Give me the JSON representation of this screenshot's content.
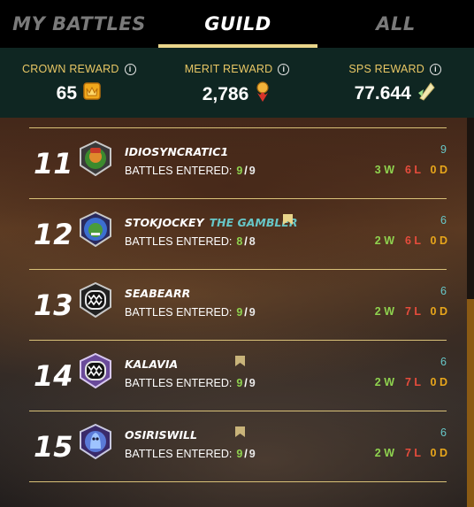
{
  "tabs": [
    {
      "label": "MY BATTLES",
      "active": false
    },
    {
      "label": "GUILD",
      "active": true
    },
    {
      "label": "ALL",
      "active": false
    }
  ],
  "rewards": [
    {
      "label": "CROWN REWARD",
      "value": "65",
      "icon": "crown-token-icon"
    },
    {
      "label": "MERIT REWARD",
      "value": "2,786",
      "icon": "merit-medal-icon"
    },
    {
      "label": "SPS REWARD",
      "value": "77.644",
      "icon": "sps-crystal-icon"
    }
  ],
  "info_glyph": "i",
  "battles_label": "BATTLES ENTERED:",
  "rows": [
    {
      "rank": "11",
      "name": "IDIOSYNCRATIC1",
      "title": "",
      "flag": false,
      "entered": "9",
      "total": "9",
      "score": "9",
      "w": "3 W",
      "l": "6 L",
      "d": "0 D",
      "avatar": "warrior-avatar-icon"
    },
    {
      "rank": "12",
      "name": "STOKJOCKEY",
      "title": "THE GAMBLER",
      "flag": true,
      "entered": "8",
      "total": "8",
      "score": "6",
      "w": "2 W",
      "l": "6 L",
      "d": "0 D",
      "avatar": "goblin-avatar-icon"
    },
    {
      "rank": "13",
      "name": "SEABEARR",
      "title": "",
      "flag": false,
      "entered": "9",
      "total": "9",
      "score": "6",
      "w": "2 W",
      "l": "7 L",
      "d": "0 D",
      "avatar": "monster-mouth-avatar-icon"
    },
    {
      "rank": "14",
      "name": "KALAVIA",
      "title": "",
      "flag": true,
      "entered": "9",
      "total": "9",
      "score": "6",
      "w": "2 W",
      "l": "7 L",
      "d": "0 D",
      "avatar": "monster-mouth-avatar-icon"
    },
    {
      "rank": "15",
      "name": "OSIRISWILL",
      "title": "",
      "flag": true,
      "entered": "9",
      "total": "9",
      "score": "6",
      "w": "2 W",
      "l": "7 L",
      "d": "0 D",
      "avatar": "spirit-avatar-icon"
    }
  ],
  "colors": {
    "accent_gold": "#e9d58a",
    "reward_bg": "#0f2622",
    "win": "#8fd34f",
    "loss": "#e74c3c",
    "draw": "#e8a61b",
    "title_teal": "#67c6c7"
  }
}
